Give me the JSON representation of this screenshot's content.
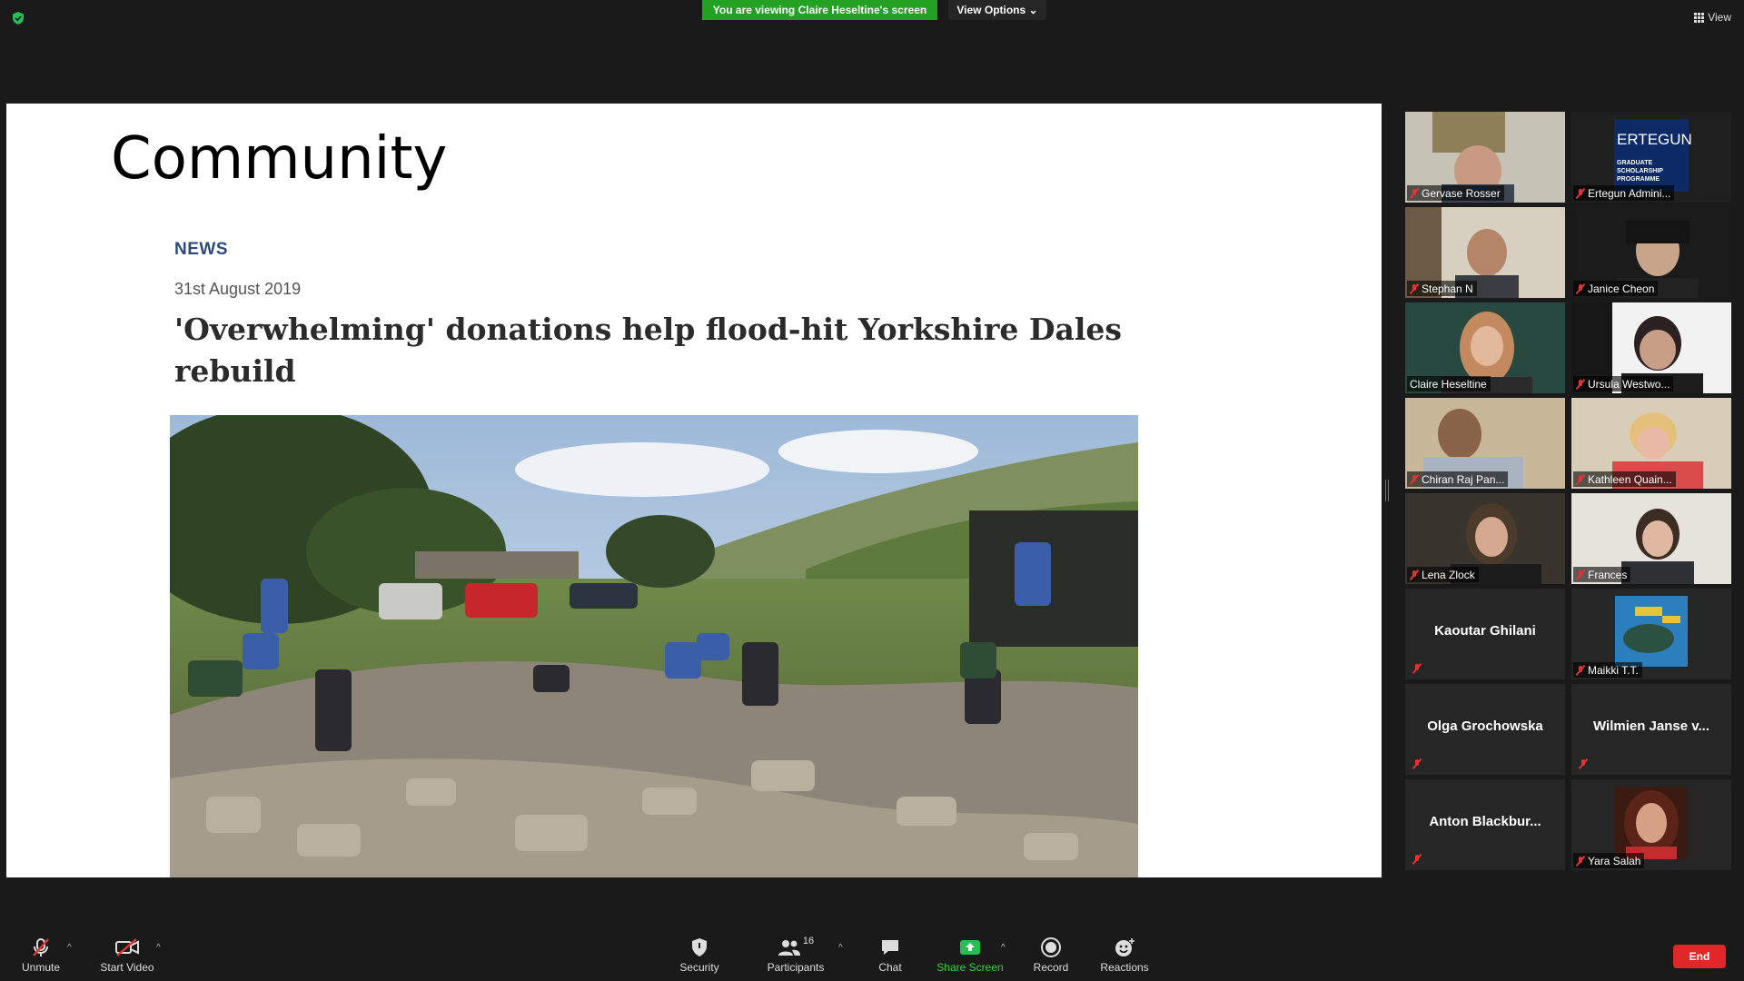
{
  "top": {
    "viewing_banner": "You are viewing Claire Heseltine's screen",
    "view_options": "View Options",
    "view_button": "View"
  },
  "slide": {
    "title": "Community",
    "news_label": "NEWS",
    "date": "31st August 2019",
    "headline": "'Overwhelming' donations help flood-hit Yorkshire Dales rebuild"
  },
  "participants": [
    {
      "name": "Gervase Rosser",
      "muted": true,
      "video": true
    },
    {
      "name": "Ertegun Admini...",
      "muted": true,
      "video": true,
      "logo_text": "ERTEGUN",
      "logo_sub": "GRADUATE SCHOLARSHIP PROGRAMME"
    },
    {
      "name": "Stephan N",
      "muted": true,
      "video": true
    },
    {
      "name": "Janice Cheon",
      "muted": true,
      "video": true
    },
    {
      "name": "Claire Heseltine",
      "muted": false,
      "video": true,
      "active_speaker": true
    },
    {
      "name": "Ursula Westwo...",
      "muted": true,
      "video": true
    },
    {
      "name": "Chiran Raj Pan...",
      "muted": true,
      "video": true
    },
    {
      "name": "Kathleen Quain...",
      "muted": true,
      "video": true
    },
    {
      "name": "Lena Zlock",
      "muted": true,
      "video": true
    },
    {
      "name": "Frances",
      "muted": true,
      "video": true
    },
    {
      "name": "Kaoutar Ghilani",
      "muted": true,
      "video": false
    },
    {
      "name": "Maikki T.T.",
      "muted": true,
      "video": false,
      "avatar": true
    },
    {
      "name": "Olga Grochowska",
      "muted": true,
      "video": false
    },
    {
      "name": "Wilmien Janse v...",
      "muted": true,
      "video": false
    },
    {
      "name": "Anton  Blackbur...",
      "muted": true,
      "video": false
    },
    {
      "name": "Yara Salah",
      "muted": true,
      "video": false,
      "avatar": true
    }
  ],
  "toolbar": {
    "unmute": "Unmute",
    "start_video": "Start Video",
    "security": "Security",
    "participants": "Participants",
    "participants_count": "16",
    "chat": "Chat",
    "share_screen": "Share Screen",
    "record": "Record",
    "reactions": "Reactions",
    "end": "End"
  },
  "colors": {
    "share_green": "#23a123",
    "end_red": "#e02828",
    "active_speaker": "#e5e04a",
    "news_blue": "#2c4a7e"
  }
}
